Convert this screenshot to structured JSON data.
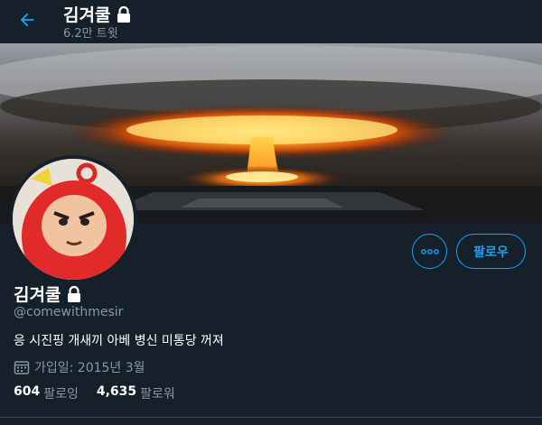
{
  "header": {
    "name": "김겨쿨",
    "tweet_count": "6.2만 트윗"
  },
  "profile": {
    "display_name": "김겨쿨",
    "handle": "@comewithmesir",
    "bio": "응 시진핑 개새끼 아베 병신 미통당 꺼져",
    "joined": "가입일: 2015년 3월",
    "following_count": "604",
    "following_label": "팔로잉",
    "followers_count": "4,635",
    "followers_label": "팔로워"
  },
  "actions": {
    "follow_label": "팔로우"
  },
  "colors": {
    "background": "#15202b",
    "accent": "#1da1f2",
    "secondary_text": "#8899a6"
  },
  "icons": {
    "back": "arrow-left-icon",
    "lock": "lock-icon",
    "more": "more-dots-icon",
    "calendar": "calendar-icon"
  }
}
